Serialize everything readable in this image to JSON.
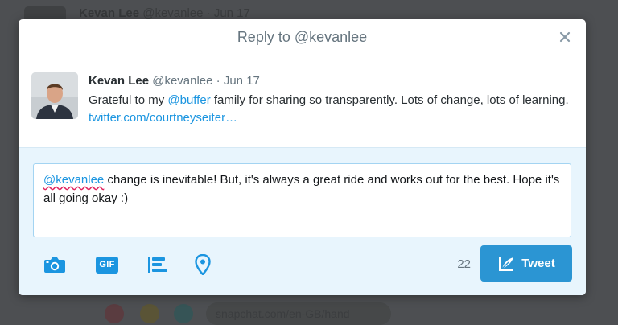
{
  "background": {
    "header_name": "Kevan Lee",
    "header_meta": "@kevanlee · Jun 17",
    "footer_link": "snapchat.com/en-GB/hand"
  },
  "modal": {
    "title": "Reply to @kevanlee",
    "close_icon": "close-icon"
  },
  "tweet": {
    "name": "Kevan Lee",
    "handle": "@kevanlee",
    "separator": "·",
    "date": "Jun 17",
    "text_before": "Grateful to my ",
    "mention": "@buffer",
    "text_after": " family for sharing so transparently. Lots of change, lots of learning. ",
    "link": "twitter.com/courtneyseiter…"
  },
  "compose": {
    "mention": "@kevanlee",
    "text": " change is inevitable! But, it's always a great ride and works out for the best. Hope it's all going okay :)",
    "tools": [
      "camera-icon",
      "gif-icon",
      "poll-icon",
      "location-icon"
    ],
    "gif_label": "GIF",
    "counter": "22",
    "tweet_button": "Tweet"
  },
  "colors": {
    "accent": "#1b95e0",
    "tweet_button": "#2b95d3",
    "compose_bg": "#e8f5fd",
    "overlay": "#4d4f52"
  }
}
